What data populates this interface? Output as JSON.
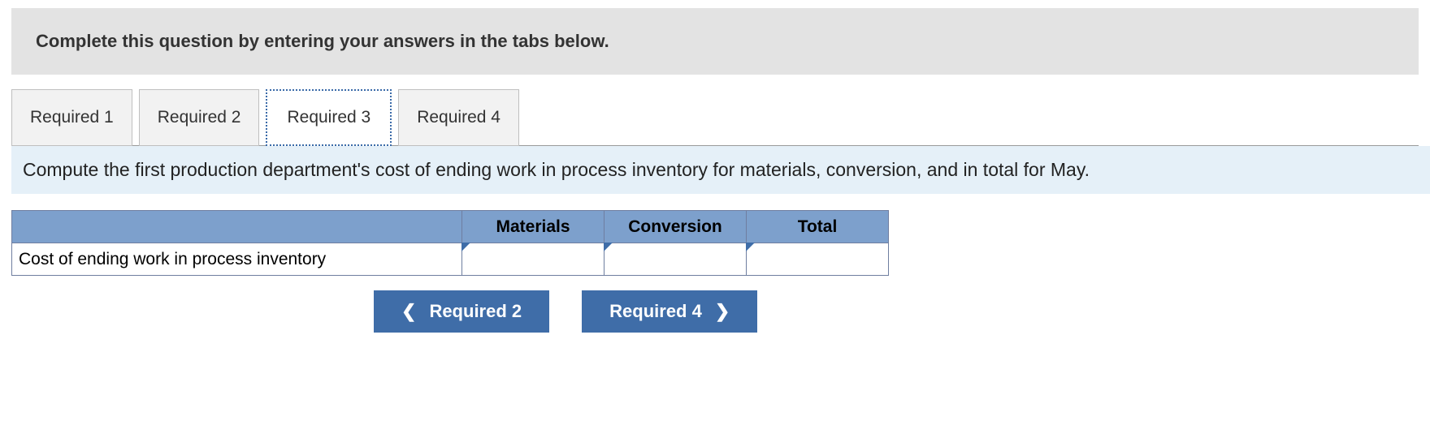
{
  "instruction": "Complete this question by entering your answers in the tabs below.",
  "tabs": [
    {
      "label": "Required 1"
    },
    {
      "label": "Required 2"
    },
    {
      "label": "Required 3"
    },
    {
      "label": "Required 4"
    }
  ],
  "active_tab_index": 2,
  "prompt": "Compute the first production department's cost of ending work in process inventory for materials, conversion, and in total for May.",
  "table": {
    "columns": [
      "Materials",
      "Conversion",
      "Total"
    ],
    "row_label": "Cost of ending work in process inventory",
    "values": [
      "",
      "",
      ""
    ]
  },
  "nav": {
    "prev_label": "Required 2",
    "next_label": "Required 4"
  }
}
